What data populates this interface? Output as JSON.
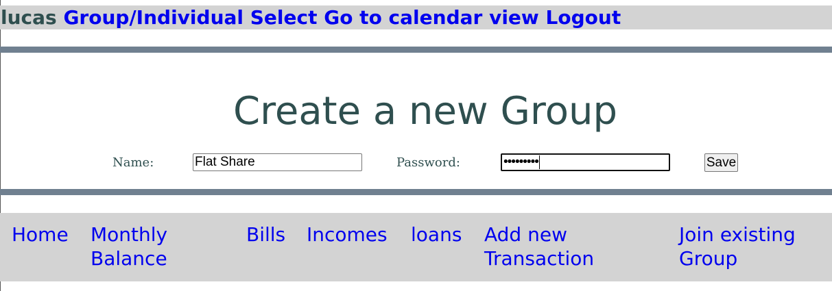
{
  "topbar": {
    "username": "lucas",
    "links": [
      "Group/Individual Select",
      "Go to calendar view",
      "Logout"
    ]
  },
  "page_title": "Create a new Group",
  "form": {
    "name_label": "Name:",
    "name_value": "Flat Share",
    "password_label": "Password:",
    "password_value": "•••••••••",
    "save_label": "Save"
  },
  "nav": {
    "home": "Home",
    "monthly_balance_line1": "Monthly",
    "monthly_balance_line2": "Balance",
    "bills": "Bills",
    "incomes": "Incomes",
    "loans": "loans",
    "add_transaction_line1": "Add new",
    "add_transaction_line2": "Transaction",
    "join_group_line1": "Join existing",
    "join_group_line2": "Group"
  },
  "colors": {
    "link": "#0000ee",
    "header_text": "#2f4f4f",
    "bar_gray": "#d3d3d3",
    "rule": "#708090"
  }
}
